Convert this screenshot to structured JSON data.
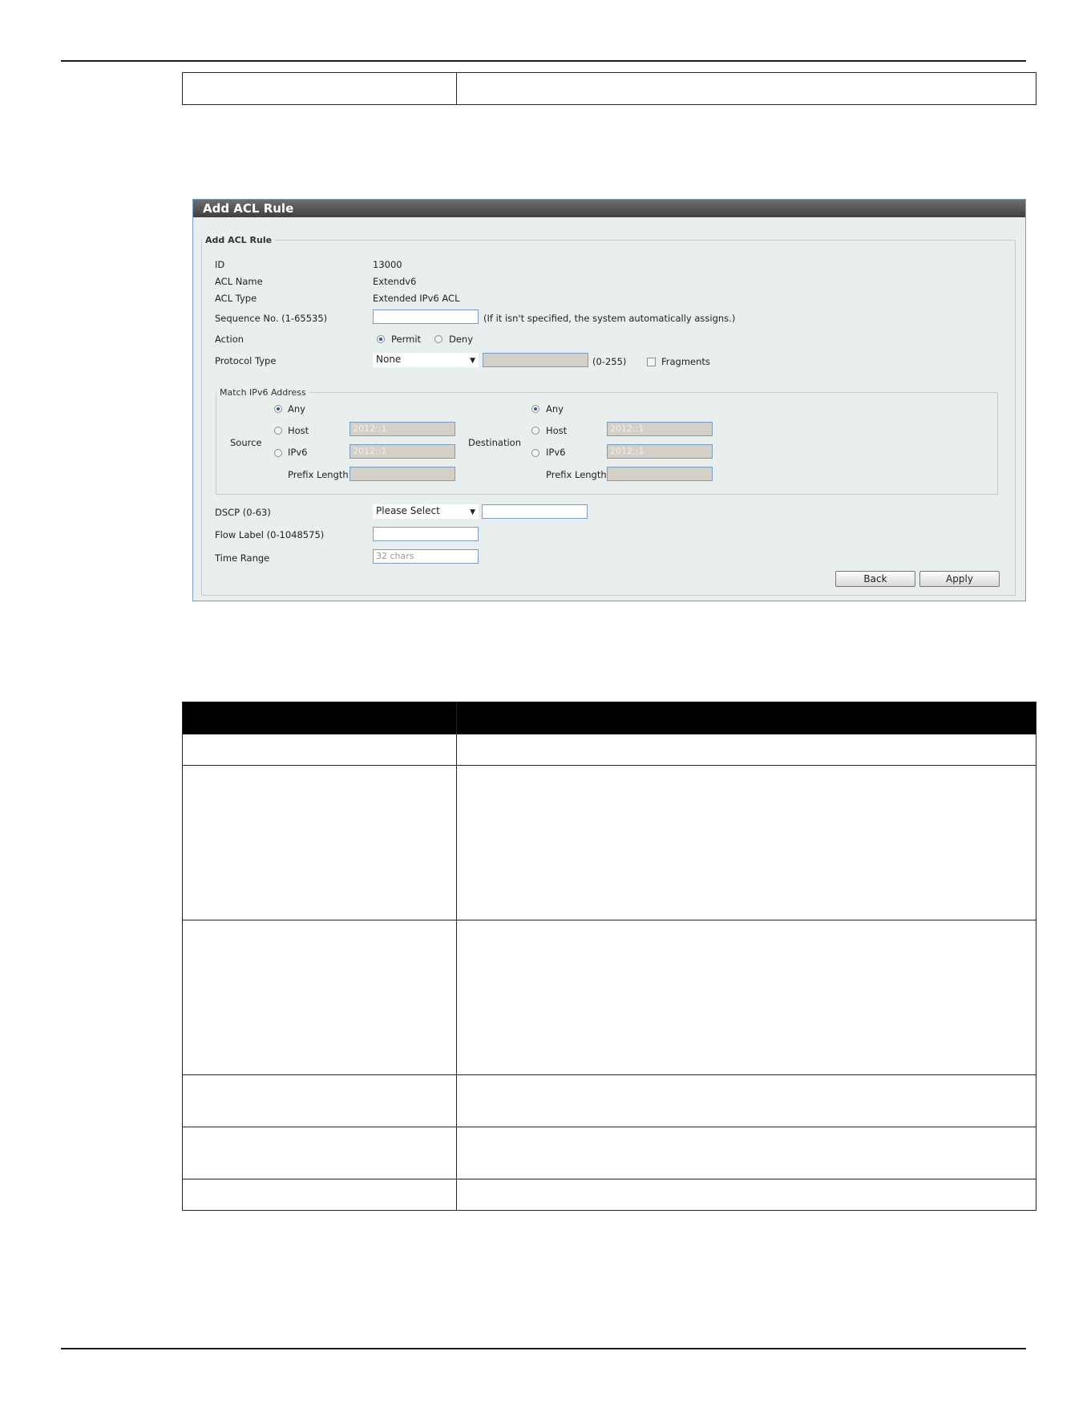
{
  "window": {
    "title": "Add ACL Rule",
    "fieldset_legend": "Add ACL Rule",
    "fields": {
      "id_label": "ID",
      "id_value": "13000",
      "acl_name_label": "ACL Name",
      "acl_name_value": "Extendv6",
      "acl_type_label": "ACL Type",
      "acl_type_value": "Extended IPv6 ACL",
      "sequence_label": "Sequence No. (1-65535)",
      "sequence_hint": "(If it isn't specified, the system automatically assigns.)",
      "action_label": "Action",
      "action_permit": "Permit",
      "action_deny": "Deny",
      "protocol_label": "Protocol Type",
      "protocol_value": "None",
      "protocol_range": "(0-255)",
      "fragments_label": "Fragments",
      "dscp_label": "DSCP (0-63)",
      "dscp_value": "Please Select",
      "flow_label": "Flow Label (0-1048575)",
      "time_range_label": "Time Range",
      "time_range_placeholder": "32 chars"
    },
    "match_ipv6": {
      "legend": "Match IPv6 Address",
      "source_label": "Source",
      "destination_label": "Destination",
      "any": "Any",
      "host": "Host",
      "ipv6": "IPv6",
      "prefix_length": "Prefix Length",
      "host_placeholder": "2012::1",
      "ipv6_placeholder": "2012::1"
    },
    "buttons": {
      "back": "Back",
      "apply": "Apply"
    }
  },
  "colors": {
    "title_bar": "#4a4a4a",
    "panel_bg": "#e9efef",
    "input_border": "#7a9cc0",
    "table_header": "#000000"
  }
}
